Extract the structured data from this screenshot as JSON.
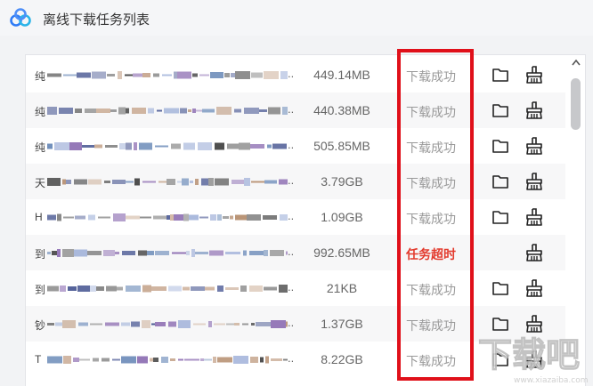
{
  "window": {
    "title": "离线下载任务列表",
    "logo_icon": "cloud-logo-icon"
  },
  "tasks": [
    {
      "prefix": "纯",
      "size": "449.14MB",
      "status": "下载成功",
      "failed": false,
      "has_folder": true
    },
    {
      "prefix": "纯",
      "size": "440.38MB",
      "status": "下载成功",
      "failed": false,
      "has_folder": true
    },
    {
      "prefix": "纯",
      "size": "505.85MB",
      "status": "下载成功",
      "failed": false,
      "has_folder": true
    },
    {
      "prefix": "天",
      "size": "3.79GB",
      "status": "下载成功",
      "failed": false,
      "has_folder": true
    },
    {
      "prefix": "H",
      "size": "1.09GB",
      "status": "下载成功",
      "failed": false,
      "has_folder": true
    },
    {
      "prefix": "到",
      "size": "992.65MB",
      "status": "任务超时",
      "failed": true,
      "has_folder": false
    },
    {
      "prefix": "到",
      "size": "21KB",
      "status": "下载成功",
      "failed": false,
      "has_folder": true
    },
    {
      "prefix": "钞",
      "size": "1.37GB",
      "status": "下载成功",
      "failed": false,
      "has_folder": true
    },
    {
      "prefix": "T",
      "size": "8.22GB",
      "status": "下载成功",
      "failed": false,
      "has_folder": true
    }
  ],
  "filename_ellipsis": "...",
  "colors": {
    "status_success": "#9a9a9a",
    "status_failed": "#e33b2e",
    "highlight": "#e0101a"
  },
  "watermark": {
    "text": "下载吧",
    "url": "www.xiazaiba.com"
  }
}
